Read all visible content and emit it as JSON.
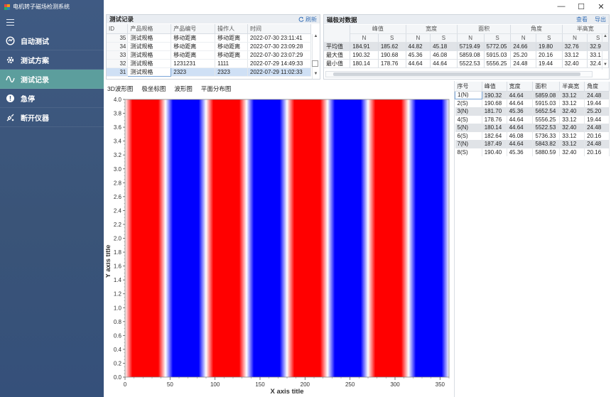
{
  "app": {
    "title": "电机转子磁场检测系统"
  },
  "window_controls": {
    "minimize": "—",
    "maximize": "☐",
    "close": "✕"
  },
  "sidebar": {
    "items": [
      {
        "label": "自动测试",
        "icon": "auto-test-icon",
        "active": false
      },
      {
        "label": "测试方案",
        "icon": "gear-icon",
        "active": false
      },
      {
        "label": "测试记录",
        "icon": "wave-icon",
        "active": true
      },
      {
        "label": "急停",
        "icon": "alert-icon",
        "active": false
      },
      {
        "label": "断开仪器",
        "icon": "disconnect-icon",
        "active": false
      }
    ]
  },
  "records": {
    "title": "测试记录",
    "refresh_label": "刷新",
    "columns": [
      "ID",
      "产品规格",
      "产品编号",
      "操作人",
      "时间"
    ],
    "rows": [
      {
        "id": "35",
        "spec": "测试规格",
        "number": "移动距离",
        "operator": "移动距离",
        "time": "2022-07-30 23:11:41"
      },
      {
        "id": "34",
        "spec": "测试规格",
        "number": "移动距离",
        "operator": "移动距离",
        "time": "2022-07-30 23:09:28"
      },
      {
        "id": "33",
        "spec": "测试规格",
        "number": "移动距离",
        "operator": "移动距离",
        "time": "2022-07-30 23:07:29"
      },
      {
        "id": "32",
        "spec": "测试规格",
        "number": "1231231",
        "operator": "1111",
        "time": "2022-07-29 14:49:33"
      },
      {
        "id": "31",
        "spec": "测试规格",
        "number": "2323",
        "operator": "2323",
        "time": "2022-07-29 11:02:33"
      }
    ]
  },
  "extrema": {
    "title": "磁极对数据",
    "view_label": "查看",
    "export_label": "导出",
    "groups": [
      "峰值",
      "宽度",
      "面积",
      "角度",
      "半高宽"
    ],
    "subheaders": [
      "N",
      "S"
    ],
    "rows": [
      {
        "label": "平均值",
        "values": [
          "184.91",
          "185.62",
          "44.82",
          "45.18",
          "5719.49",
          "5772.05",
          "24.66",
          "19.80",
          "32.76",
          "32.9"
        ]
      },
      {
        "label": "最大值",
        "values": [
          "190.32",
          "190.68",
          "45.36",
          "46.08",
          "5859.08",
          "5915.03",
          "25.20",
          "20.16",
          "33.12",
          "33.1"
        ]
      },
      {
        "label": "最小值",
        "values": [
          "180.14",
          "178.76",
          "44.64",
          "44.64",
          "5522.53",
          "5556.25",
          "24.48",
          "19.44",
          "32.40",
          "32.4"
        ]
      }
    ]
  },
  "tabs": [
    "3D波形图",
    "极坐标图",
    "波形图",
    "平面分布图"
  ],
  "poles": {
    "columns": [
      "序号",
      "峰值",
      "宽度",
      "面积",
      "半高宽",
      "角度"
    ],
    "rows": [
      [
        "1(N)",
        "190.32",
        "44.64",
        "5859.08",
        "33.12",
        "24.48"
      ],
      [
        "2(S)",
        "190.68",
        "44.64",
        "5915.03",
        "33.12",
        "19.44"
      ],
      [
        "3(N)",
        "181.70",
        "45.36",
        "5652.54",
        "32.40",
        "25.20"
      ],
      [
        "4(S)",
        "178.76",
        "44.64",
        "5556.25",
        "33.12",
        "19.44"
      ],
      [
        "5(N)",
        "180.14",
        "44.64",
        "5522.53",
        "32.40",
        "24.48"
      ],
      [
        "6(S)",
        "182.64",
        "46.08",
        "5736.33",
        "33.12",
        "20.16"
      ],
      [
        "7(N)",
        "187.49",
        "44.64",
        "5843.82",
        "33.12",
        "24.48"
      ],
      [
        "8(S)",
        "190.40",
        "45.36",
        "5880.59",
        "32.40",
        "20.16"
      ]
    ]
  },
  "chart_data": {
    "type": "heatmap",
    "xlabel": "X axis title",
    "ylabel": "Y axis title",
    "xlim": [
      0,
      360
    ],
    "ylim": [
      0,
      4.0
    ],
    "xticks": [
      0,
      50,
      100,
      150,
      200,
      250,
      300,
      350
    ],
    "yticks": [
      0.0,
      0.2,
      0.4,
      0.6,
      0.8,
      1.0,
      1.2,
      1.4,
      1.6,
      1.8,
      2.0,
      2.2,
      2.4,
      2.6,
      2.8,
      3.0,
      3.2,
      3.4,
      3.6,
      3.8,
      4.0
    ],
    "colors": {
      "positive": "#ff0000",
      "negative": "#0000ff",
      "zero": "#ffffff"
    },
    "pole_bands": [
      {
        "pole": "N",
        "x_start": 0,
        "x_end": 45
      },
      {
        "pole": "S",
        "x_start": 45,
        "x_end": 90
      },
      {
        "pole": "N",
        "x_start": 90,
        "x_end": 135
      },
      {
        "pole": "S",
        "x_start": 135,
        "x_end": 180
      },
      {
        "pole": "N",
        "x_start": 180,
        "x_end": 225
      },
      {
        "pole": "S",
        "x_start": 225,
        "x_end": 270
      },
      {
        "pole": "N",
        "x_start": 270,
        "x_end": 315
      },
      {
        "pole": "S",
        "x_start": 315,
        "x_end": 360
      }
    ]
  }
}
